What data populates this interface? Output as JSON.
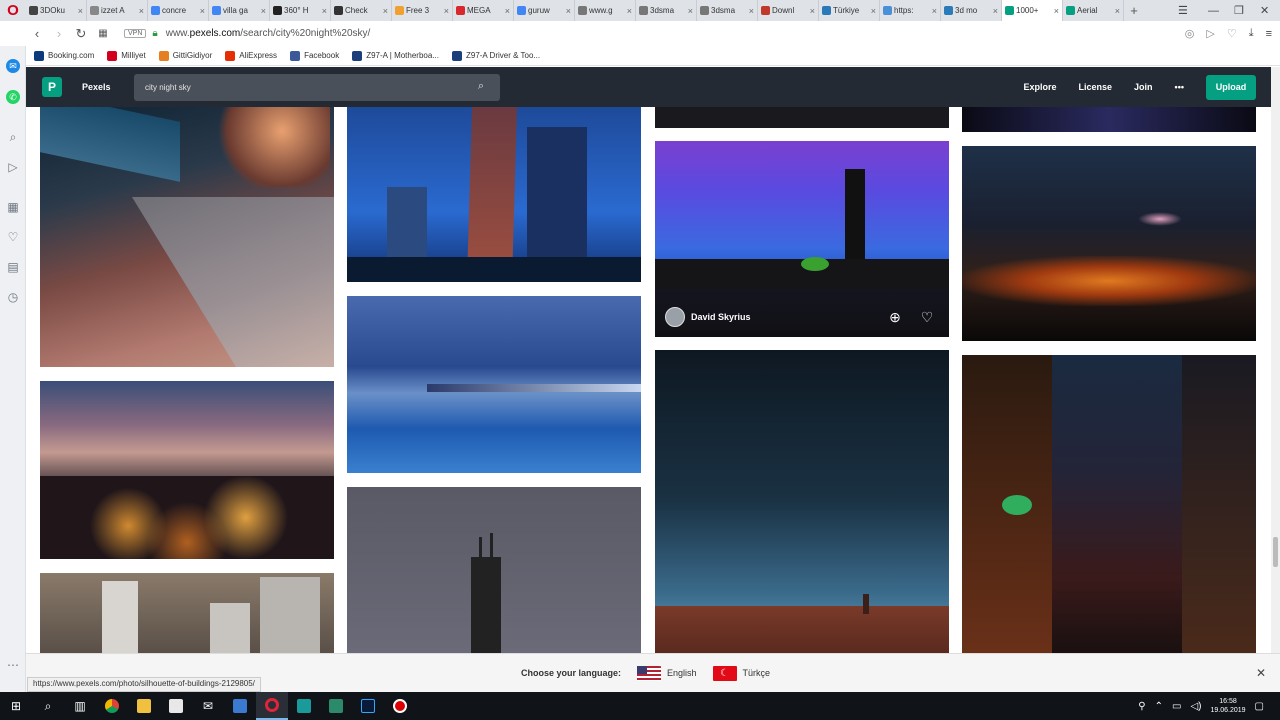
{
  "browser": {
    "tabs": [
      {
        "label": "3DOku",
        "color": "#444444"
      },
      {
        "label": "izzet A",
        "color": "#888888"
      },
      {
        "label": "concre",
        "color": "#4285f4"
      },
      {
        "label": "villa ga",
        "color": "#4285f4"
      },
      {
        "label": "360° H",
        "color": "#222222"
      },
      {
        "label": "Check",
        "color": "#333333"
      },
      {
        "label": "Free 3",
        "color": "#f0a030"
      },
      {
        "label": "MEGA",
        "color": "#d9272e"
      },
      {
        "label": "guruw",
        "color": "#4285f4"
      },
      {
        "label": "www.g",
        "color": "#777777"
      },
      {
        "label": "3dsma",
        "color": "#777777"
      },
      {
        "label": "3dsma",
        "color": "#777777"
      },
      {
        "label": "Downl",
        "color": "#c0392b"
      },
      {
        "label": "Türkiye",
        "color": "#2a7ab8"
      },
      {
        "label": "https:",
        "color": "#4a90d9"
      },
      {
        "label": "3d mo",
        "color": "#2b7bb9"
      },
      {
        "label": "1000+",
        "color": "#05a081"
      },
      {
        "label": "Aerial",
        "color": "#05a081"
      }
    ],
    "url_prefix": "www.",
    "url_domain": "pexels.com",
    "url_path": "/search/city%20night%20sky/",
    "vpn_label": "VPN",
    "bookmarks": [
      {
        "label": "Booking.com",
        "color": "#0c3b7c"
      },
      {
        "label": "Milliyet",
        "color": "#d2001c"
      },
      {
        "label": "GittiGidiyor",
        "color": "#e67e22"
      },
      {
        "label": "AliExpress",
        "color": "#e62e04"
      },
      {
        "label": "Facebook",
        "color": "#3b5998"
      },
      {
        "label": "Z97-A | Motherboa...",
        "color": "#1b3f7a"
      },
      {
        "label": "Z97-A Driver & Too...",
        "color": "#1b3f7a"
      }
    ]
  },
  "pexels": {
    "logo_letter": "P",
    "brand": "Pexels",
    "search_value": "city night sky",
    "nav": [
      "Explore",
      "License",
      "Join",
      "•••"
    ],
    "upload_label": "Upload"
  },
  "gallery": {
    "hover_photographer": "David Skyrius"
  },
  "language_bar": {
    "prompt": "Choose your language:",
    "options": [
      "English",
      "Türkçe"
    ]
  },
  "status_url": "https://www.pexels.com/photo/silhouette-of-buildings-2129805/",
  "taskbar": {
    "time": "16:58",
    "date": "19.06.2019"
  },
  "colors": {
    "brand_green": "#05a081",
    "header_bg": "#232a34"
  }
}
